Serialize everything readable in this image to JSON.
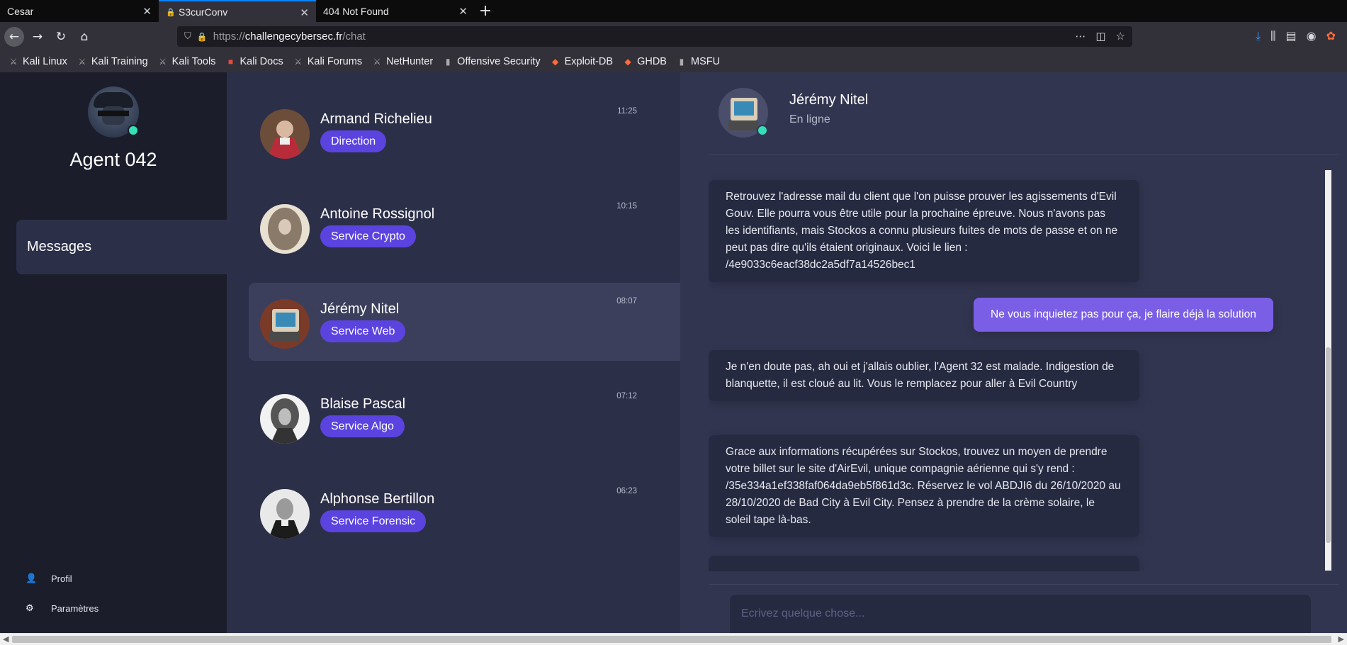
{
  "browser": {
    "tabs": [
      {
        "title": "Cesar"
      },
      {
        "title": "S3curConv"
      },
      {
        "title": "404 Not Found"
      }
    ],
    "url_scheme": "https://",
    "url_host": "challengecybersec.fr",
    "url_path": "/chat",
    "bookmarks": [
      "Kali Linux",
      "Kali Training",
      "Kali Tools",
      "Kali Docs",
      "Kali Forums",
      "NetHunter",
      "Offensive Security",
      "Exploit-DB",
      "GHDB",
      "MSFU"
    ]
  },
  "sidebar": {
    "agent_name": "Agent 042",
    "nav_messages": "Messages",
    "profil": "Profil",
    "parametres": "Paramètres"
  },
  "contacts": [
    {
      "name": "Armand Richelieu",
      "badge": "Direction",
      "time": "11:25"
    },
    {
      "name": "Antoine Rossignol",
      "badge": "Service Crypto",
      "time": "10:15"
    },
    {
      "name": "Jérémy Nitel",
      "badge": "Service Web",
      "time": "08:07"
    },
    {
      "name": "Blaise Pascal",
      "badge": "Service Algo",
      "time": "07:12"
    },
    {
      "name": "Alphonse Bertillon",
      "badge": "Service Forensic",
      "time": "06:23"
    }
  ],
  "chat": {
    "name": "Jérémy Nitel",
    "status": "En ligne",
    "messages": [
      {
        "from": "in",
        "text": "Retrouvez l'adresse mail du client que l'on puisse prouver les agissements d'Evil Gouv. Elle pourra vous être utile pour la prochaine épreuve. Nous n'avons pas les identifiants, mais Stockos a connu plusieurs fuites de mots de passe et on ne peut pas dire qu'ils étaient originaux. Voici le lien : /4e9033c6eacf38dc2a5df7a14526bec1"
      },
      {
        "from": "out",
        "text": "Ne vous inquietez pas pour ça, je flaire déjà la solution"
      },
      {
        "from": "in",
        "text": "Je n'en doute pas, ah oui et j'allais oublier, l'Agent 32 est malade. Indigestion de blanquette, il est cloué au lit. Vous le remplacez pour aller à Evil Country"
      },
      {
        "from": "in",
        "text": "Grace aux informations récupérées sur Stockos, trouvez un moyen de prendre votre billet sur le site d'AirEvil, unique compagnie aérienne qui s'y rend : /35e334a1ef338faf064da9eb5f861d3c. Réservez le vol ABDJI6 du 26/10/2020 au 28/10/2020 de Bad City à Evil City. Pensez à prendre de la crème solaire, le soleil tape là-bas."
      },
      {
        "from": "in",
        "text": ""
      }
    ],
    "input_placeholder": "Ecrivez quelque chose..."
  }
}
